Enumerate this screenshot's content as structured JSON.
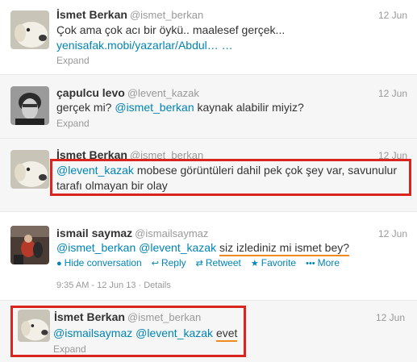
{
  "tweets": [
    {
      "name": "İsmet Berkan",
      "handle": "@ismet_berkan",
      "time": "12 Jun",
      "text": "Çok ama çok acı bir öykü.. maalesef gerçek...",
      "link": "yenisafak.mobi/yazarlar/Abdul…",
      "link_suffix": " …",
      "expand": "Expand"
    },
    {
      "name": "çapulcu levo",
      "handle": "@levent_kazak",
      "time": "12 Jun",
      "text_pre": "gerçek mi? ",
      "mention": "@ismet_berkan",
      "text_post": " kaynak alabilir miyiz?",
      "expand": "Expand"
    },
    {
      "name": "İsmet Berkan",
      "handle": "@ismet_berkan",
      "time": "12 Jun",
      "mention": "@levent_kazak",
      "text_post": " mobese görüntüleri dahil pek çok şey var, savunulur tarafı olmayan bir olay"
    },
    {
      "name": "ismail saymaz",
      "handle": "@ismailsaymaz",
      "time": "12 Jun",
      "mention1": "@ismet_berkan",
      "mention2": "@levent_kazak",
      "text_post": "siz izlediniz mi ismet bey?",
      "actions": {
        "hide": "Hide conversation",
        "reply": "Reply",
        "retweet": "Retweet",
        "favorite": "Favorite",
        "more": "More"
      },
      "meta": "9:35 AM - 12 Jun 13 · Details"
    },
    {
      "name": "İsmet Berkan",
      "handle": "@ismet_berkan",
      "time": "12 Jun",
      "mention1": "@ismailsaymaz",
      "mention2": "@levent_kazak",
      "text_post": "evet",
      "expand": "Expand"
    }
  ],
  "colors": {
    "link": "#0084b4",
    "highlight_box": "#d9251d",
    "underline": "#f08c1e"
  }
}
